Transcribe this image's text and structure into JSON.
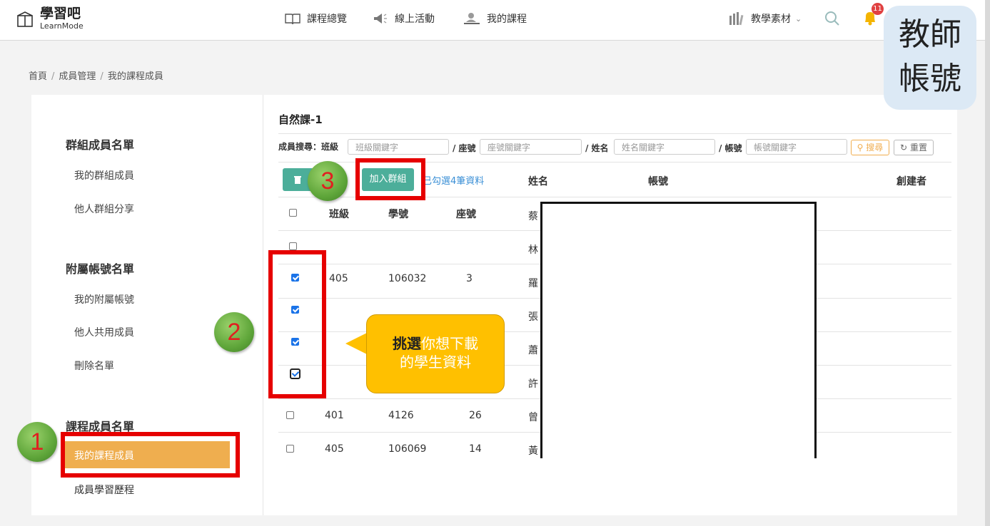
{
  "header": {
    "logo_title": "學習吧",
    "logo_sub": "LearnMode",
    "nav": [
      {
        "label": "課程總覽",
        "icon": "book-icon"
      },
      {
        "label": "線上活動",
        "icon": "megaphone-icon"
      },
      {
        "label": "我的課程",
        "icon": "user-desk-icon"
      },
      {
        "label": "教學素材",
        "icon": "library-icon"
      }
    ],
    "notification_count": "11"
  },
  "breadcrumb": [
    "首頁",
    "成員管理",
    "我的課程成員"
  ],
  "sidebar": {
    "group1_title": "群組成員名單",
    "group1_items": [
      "我的群組成員",
      "他人群組分享"
    ],
    "group2_title": "附屬帳號名單",
    "group2_items": [
      "我的附屬帳號",
      "他人共用成員",
      "刪除名單"
    ],
    "group3_title": "課程成員名單",
    "group3_items": [
      "我的課程成員",
      "成員學習歷程"
    ]
  },
  "main": {
    "course_title": "自然課-1",
    "search": {
      "label_prefix": "成員搜尋：班級",
      "class_placeholder": "班級關鍵字",
      "seat_label": "/ 座號",
      "seat_placeholder": "座號關鍵字",
      "name_label": "/ 姓名",
      "name_placeholder": "姓名關鍵字",
      "account_label": "/ 帳號",
      "account_placeholder": "帳號關鍵字",
      "search_button": "搜尋",
      "reset_button": "重置"
    },
    "join_group_button": "加入群組",
    "selected_info": "已勾選4筆資料",
    "columns": [
      "班級",
      "學號",
      "座號",
      "姓名",
      "帳號",
      "創建者"
    ],
    "rows": [
      {
        "class": "",
        "student_no": "",
        "seat": "",
        "name": "蔡",
        "checked": false
      },
      {
        "class": "405",
        "student_no": "106032",
        "seat": "3",
        "name": "林",
        "checked": true
      },
      {
        "class": "",
        "student_no": "",
        "seat": "",
        "name": "羅",
        "checked": true
      },
      {
        "class": "",
        "student_no": "",
        "seat": "",
        "name": "張",
        "checked": true
      },
      {
        "class": "",
        "student_no": "",
        "seat": "",
        "name": "蕭",
        "checked": true
      },
      {
        "class": "",
        "student_no": "",
        "seat": "",
        "name": "許",
        "checked": false
      },
      {
        "class": "401",
        "student_no": "4126",
        "seat": "26",
        "name": "曾",
        "checked": false
      },
      {
        "class": "405",
        "student_no": "106069",
        "seat": "14",
        "name": "黃",
        "checked": false
      }
    ]
  },
  "annotations": {
    "step1": "1",
    "step2": "2",
    "step3": "3",
    "callout_bold": "挑選",
    "callout_line1_rest": "你想下載",
    "callout_line2": "的學生資料",
    "teacher_line1": "教師",
    "teacher_line2": "帳號"
  },
  "colors": {
    "accent": "#efae4f",
    "teal": "#4cae9a",
    "highlight": "#e60000",
    "callout": "#ffc000"
  }
}
